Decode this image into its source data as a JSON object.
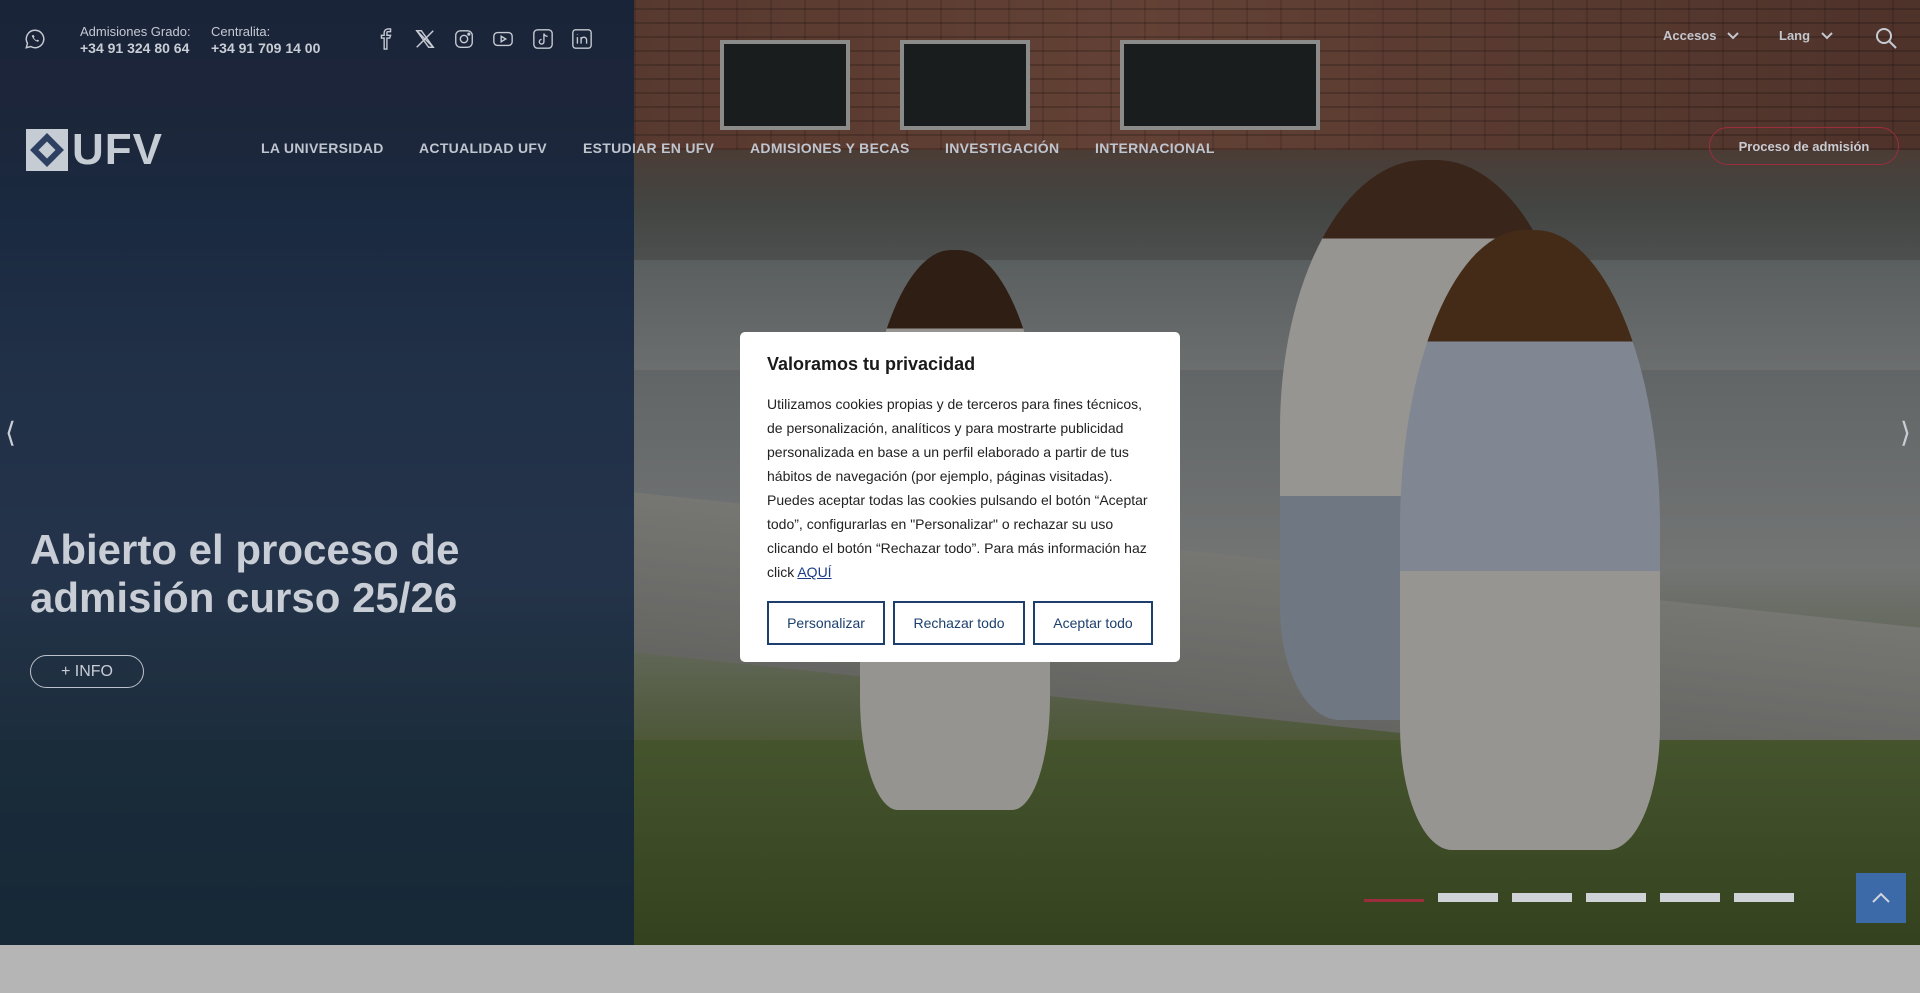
{
  "topbar": {
    "admissions_label": "Admisiones Grado:",
    "admissions_phone": "+34 91 324 80 64",
    "switchboard_label": "Centralita:",
    "switchboard_phone": "+34 91 709 14 00",
    "social_icons": [
      "facebook-icon",
      "x-icon",
      "instagram-icon",
      "youtube-icon",
      "tiktok-icon",
      "linkedin-icon"
    ],
    "accesos_label": "Accesos",
    "lang_label": "Lang"
  },
  "nav": {
    "logo_text": "UFV",
    "items": [
      "LA UNIVERSIDAD",
      "ACTUALIDAD UFV",
      "ESTUDIAR EN UFV",
      "ADMISIONES Y BECAS",
      "INVESTIGACIÓN",
      "INTERNACIONAL"
    ],
    "cta_label": "Proceso de admisión"
  },
  "hero": {
    "headline": "Abierto el proceso de admisión curso 25/26",
    "info_button": "+ INFO",
    "prev_arrow": "⟨",
    "next_arrow": "⟩",
    "slide_count": 6,
    "active_slide": 1
  },
  "cookie_modal": {
    "title": "Valoramos tu privacidad",
    "body": "Utilizamos cookies propias y de terceros para fines técnicos, de personalización, analíticos y para mostrarte publicidad personalizada en base a un perfil elaborado a partir de tus hábitos de navegación (por ejemplo, páginas visitadas). Puedes aceptar todas las cookies pulsando el botón “Aceptar todo”, configurarlas en \"Personalizar\" o rechazar su uso clicando el botón “Rechazar todo”. Para más información haz click ",
    "link_label": "AQUÍ",
    "customize_button": "Personalizar",
    "reject_button": "Rechazar todo",
    "accept_button": "Aceptar todo"
  },
  "colors": {
    "brand_blue": "#1c3f6e",
    "accent_red": "#9b2d3c",
    "overlay_blue": "#173562"
  }
}
